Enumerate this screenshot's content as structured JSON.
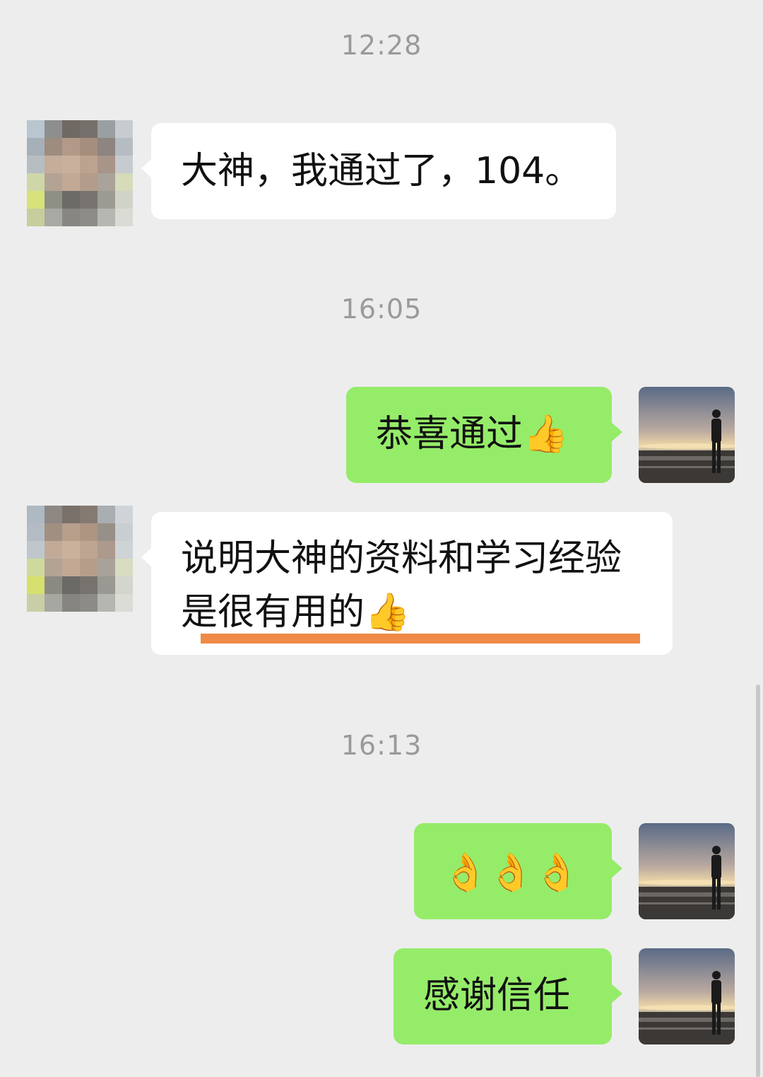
{
  "chat": {
    "messages": [
      {
        "type": "time",
        "text": "12:28"
      },
      {
        "type": "message",
        "direction": "in",
        "text": "大神，我通过了，104。"
      },
      {
        "type": "time",
        "text": "16:05"
      },
      {
        "type": "message",
        "direction": "out",
        "text": "恭喜通过",
        "emoji": "👍"
      },
      {
        "type": "message",
        "direction": "in",
        "line1": "说明大神的资料和学习经验",
        "line2": "是很有用的",
        "emoji": "👍",
        "annotation": "orange-underline"
      },
      {
        "type": "time",
        "text": "16:13"
      },
      {
        "type": "message",
        "direction": "out",
        "emoji": "👌👌👌"
      },
      {
        "type": "message",
        "direction": "out",
        "text": "感谢信任"
      }
    ]
  },
  "colors": {
    "background": "#ededed",
    "bubble_in": "#ffffff",
    "bubble_out": "#95ec69",
    "timestamp_text": "#9a9a9a",
    "annotation_underline": "#ef8b46"
  },
  "icons": {
    "contact_avatar": "pixelated-avatar-icon",
    "self_avatar": "sunset-beach-silhouette-avatar-icon"
  }
}
